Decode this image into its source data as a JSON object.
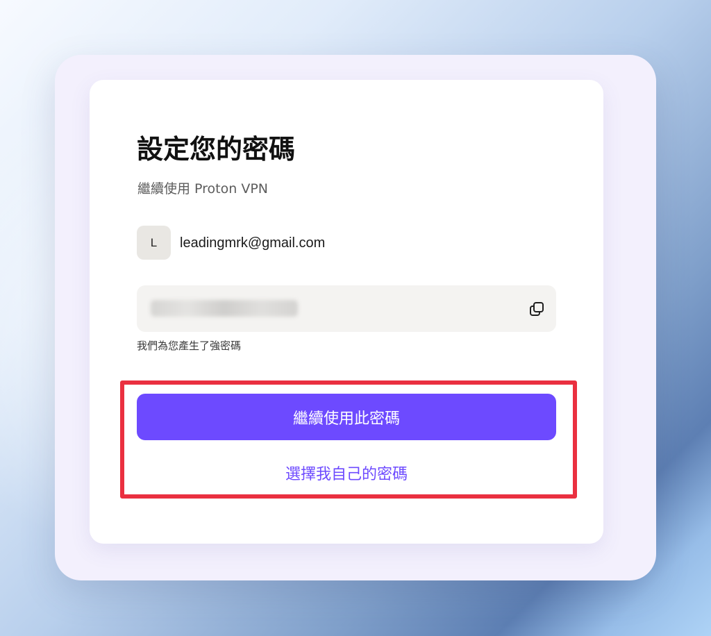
{
  "form": {
    "title": "設定您的密碼",
    "subtitle": "繼續使用 Proton VPN",
    "account": {
      "avatar_letter": "L",
      "email": "leadingmrk@gmail.com"
    },
    "password_field": {
      "copy_icon": "copy-icon"
    },
    "hint": "我們為您產生了強密碼",
    "primary_button": "繼續使用此密碼",
    "secondary_button": "選擇我自己的密碼"
  },
  "colors": {
    "accent": "#6d4aff",
    "highlight": "#ea3040",
    "field_bg": "#f4f3f1"
  }
}
